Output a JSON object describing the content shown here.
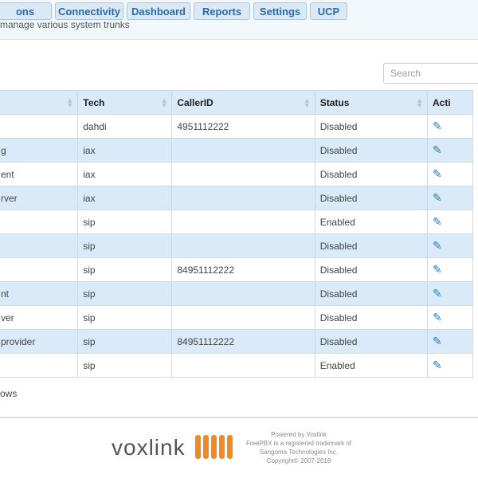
{
  "nav": {
    "tabs": [
      {
        "label": "ons"
      },
      {
        "label": "Connectivity"
      },
      {
        "label": "Dashboard"
      },
      {
        "label": "Reports"
      },
      {
        "label": "Settings"
      },
      {
        "label": "UCP"
      }
    ]
  },
  "page": {
    "subtitle": "manage various system trunks"
  },
  "search": {
    "placeholder": "Search"
  },
  "table": {
    "headers": [
      "",
      "Tech",
      "CallerID",
      "Status",
      "Acti"
    ],
    "rows": [
      {
        "name": "",
        "tech": "dahdi",
        "callerid": "4951112222",
        "status": "Disabled"
      },
      {
        "name": "g",
        "tech": "iax",
        "callerid": "",
        "status": "Disabled"
      },
      {
        "name": "ent",
        "tech": "iax",
        "callerid": "",
        "status": "Disabled"
      },
      {
        "name": "rver",
        "tech": "iax",
        "callerid": "",
        "status": "Disabled"
      },
      {
        "name": "",
        "tech": "sip",
        "callerid": "",
        "status": "Enabled"
      },
      {
        "name": "",
        "tech": "sip",
        "callerid": "",
        "status": "Disabled"
      },
      {
        "name": "",
        "tech": "sip",
        "callerid": "84951112222",
        "status": "Disabled"
      },
      {
        "name": "nt",
        "tech": "sip",
        "callerid": "",
        "status": "Disabled"
      },
      {
        "name": "ver",
        "tech": "sip",
        "callerid": "",
        "status": "Disabled"
      },
      {
        "name": "provider",
        "tech": "sip",
        "callerid": "84951112222",
        "status": "Disabled"
      },
      {
        "name": "",
        "tech": "sip",
        "callerid": "",
        "status": "Enabled"
      }
    ]
  },
  "pagination": {
    "rows_text": "ows"
  },
  "footer": {
    "brand": "voxlink",
    "powered_by": "Powered by Voxlink",
    "trademark_line1": "FreePBX is a registered trademark of",
    "trademark_line2": "Sangoma Technologies Inc.",
    "copyright": "Copyright© 2007-2018"
  },
  "colors": {
    "accent": "#2a6aa8",
    "row_alt": "#d9ebf8",
    "logo_orange": "#f08a24"
  }
}
